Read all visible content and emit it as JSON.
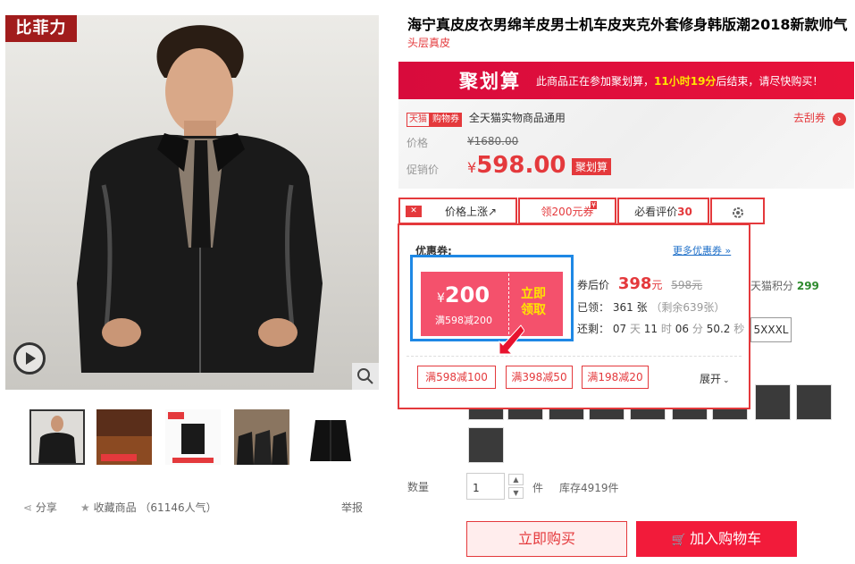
{
  "product": {
    "title": "海宁真皮皮衣男绵羊皮男士机车皮夹克外套修身韩版潮2018新款帅气",
    "subtitle": "头层真皮",
    "brand_badge": "比菲力"
  },
  "ju": {
    "logo": "聚划算",
    "text_prefix": "此商品正在参加聚划算，",
    "time_left": "11小时19分",
    "text_suffix": "后结束，请尽快购买！"
  },
  "coupon_bar": {
    "tmall": "天猫",
    "cart": "购物券",
    "desc": "全天猫实物商品通用",
    "link": "去刮券"
  },
  "price": {
    "orig_label": "价格",
    "orig_value": "¥1680.00",
    "promo_label": "促销价",
    "currency": "¥",
    "promo_value": "598.00",
    "promo_tag": "聚划算"
  },
  "tabs": [
    {
      "label": "价格上涨↗"
    },
    {
      "label": "领200元券"
    },
    {
      "label": "必看评价",
      "count": "30"
    }
  ],
  "tab_badge": "¥",
  "popup": {
    "title": "优惠券:",
    "more_link": "更多优惠券 »",
    "coupon_currency": "¥",
    "coupon_amount": "200",
    "coupon_condition": "满598减200",
    "coupon_action_1": "立即",
    "coupon_action_2": "领取",
    "after_label": "券后价",
    "after_price": "398",
    "after_unit": "元",
    "after_orig": "598元",
    "claimed_label": "已领：",
    "claimed_count": "361",
    "claimed_unit": "张",
    "remaining": "（剩余639张）",
    "countdown_label": "还剩：",
    "cd_days": "07",
    "cd_days_unit": "天",
    "cd_hours": "11",
    "cd_hours_unit": "时",
    "cd_min": "06",
    "cd_min_unit": "分",
    "cd_sec": "50.2",
    "cd_sec_unit": "秒",
    "small_coupons": [
      "满598减100",
      "满398减50",
      "满198减20"
    ],
    "expand": "展开"
  },
  "right_info": {
    "points_label": "天猫积分",
    "points_value": "299",
    "size": "5XXXL"
  },
  "quantity": {
    "label": "数量",
    "value": "1",
    "unit": "件",
    "stock": "库存4919件"
  },
  "actions": {
    "buy": "立即购买",
    "cart": "加入购物车"
  },
  "footer": {
    "share": "分享",
    "favorite": "收藏商品",
    "popularity": "（61146人气）",
    "report": "举报"
  },
  "colors": {
    "accent": "#e4393c",
    "ju": "#d80b3c",
    "highlight": "#ffe400",
    "coupon_bg": "#f4516c",
    "coupon_frame": "#1e88e5"
  }
}
